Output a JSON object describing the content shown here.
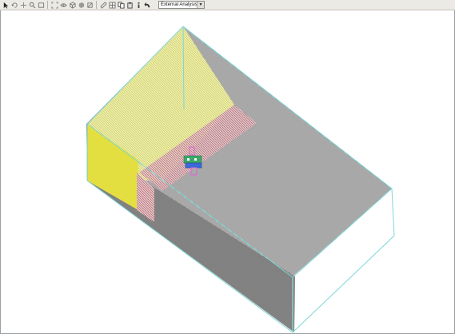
{
  "toolbar": {
    "analysis_mode": {
      "selected": "External Analysis"
    },
    "icons": [
      "pointer-icon",
      "rotate-icon",
      "pan-icon",
      "zoom-icon",
      "zoom-window-icon",
      "zoom-fit-icon",
      "view-icon",
      "wireframe-icon",
      "shade-icon",
      "section-icon",
      "measure-icon",
      "grid-icon",
      "copy-icon",
      "paste-icon",
      "info-icon",
      "arrow-back-icon"
    ]
  },
  "viewport": {
    "colors": {
      "outline": "#7fd6d6",
      "mesh_gray": "#8c8c8c",
      "mesh_yellow": "#e8e89a",
      "yellow_face": "#f0ef4c",
      "mesh_red": "#c9566a",
      "building_pink": "#e060d8",
      "building_green": "#3aa86a",
      "building_blue": "#3a6ad8"
    }
  }
}
